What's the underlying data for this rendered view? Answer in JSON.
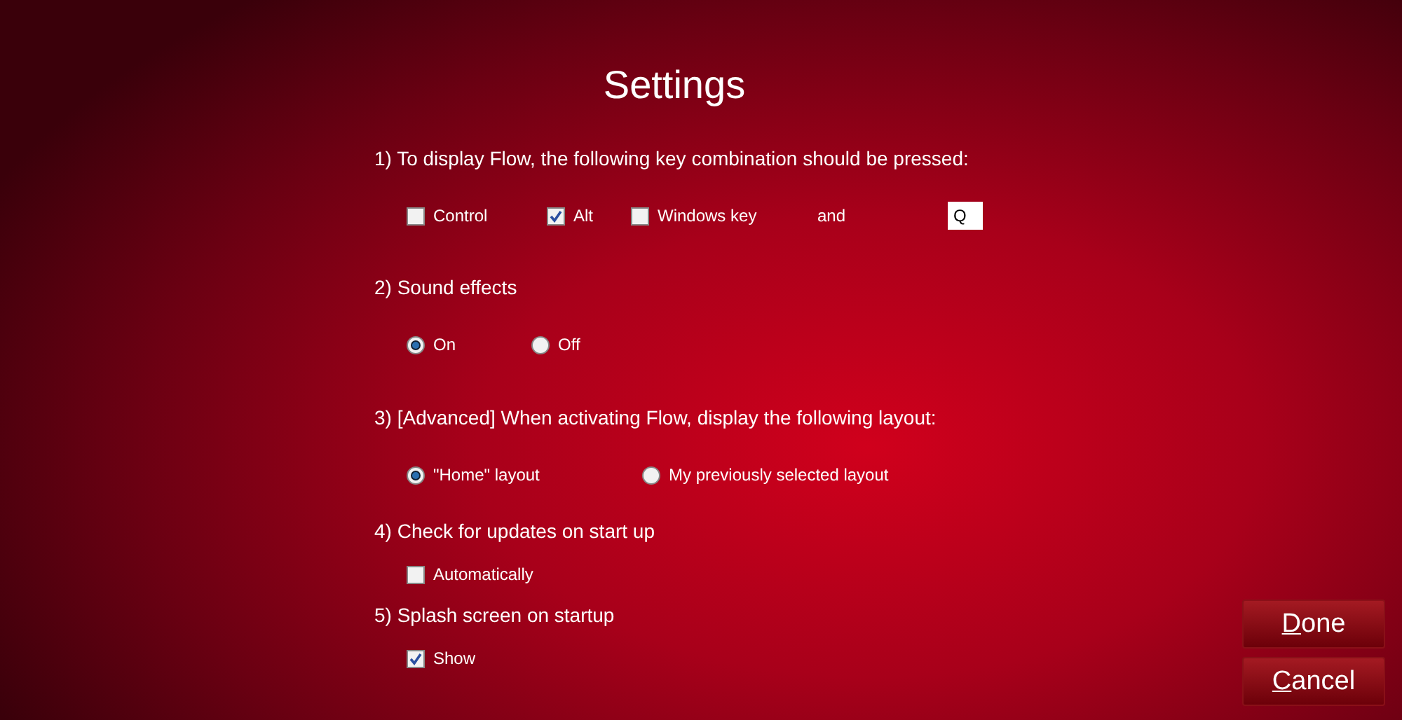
{
  "title": "Settings",
  "sections": [
    {
      "heading": "1) To display Flow, the following key combination should be pressed:",
      "kind": "checks",
      "options": [
        {
          "label": "Control",
          "checked": false
        },
        {
          "label": "Alt",
          "checked": true
        },
        {
          "label": "Windows key",
          "checked": false
        }
      ],
      "joiner": "and",
      "key_field": {
        "value": "Q"
      }
    },
    {
      "heading": "2) Sound effects",
      "kind": "radios",
      "options": [
        {
          "label": "On",
          "selected": true
        },
        {
          "label": "Off",
          "selected": false
        }
      ]
    },
    {
      "heading": "3) [Advanced] When activating Flow, display the following layout:",
      "kind": "radios",
      "options": [
        {
          "label": "\"Home\" layout",
          "selected": true
        },
        {
          "label": "My previously selected layout",
          "selected": false
        }
      ]
    },
    {
      "heading": "4) Check for updates on start up",
      "kind": "checks",
      "options": [
        {
          "label": "Automatically",
          "checked": false
        }
      ]
    },
    {
      "heading": "5) Splash screen on startup",
      "kind": "checks",
      "options": [
        {
          "label": "Show",
          "checked": true
        }
      ]
    }
  ],
  "buttons": [
    {
      "access_key": "D",
      "rest": "one"
    },
    {
      "access_key": "C",
      "rest": "ancel"
    }
  ]
}
